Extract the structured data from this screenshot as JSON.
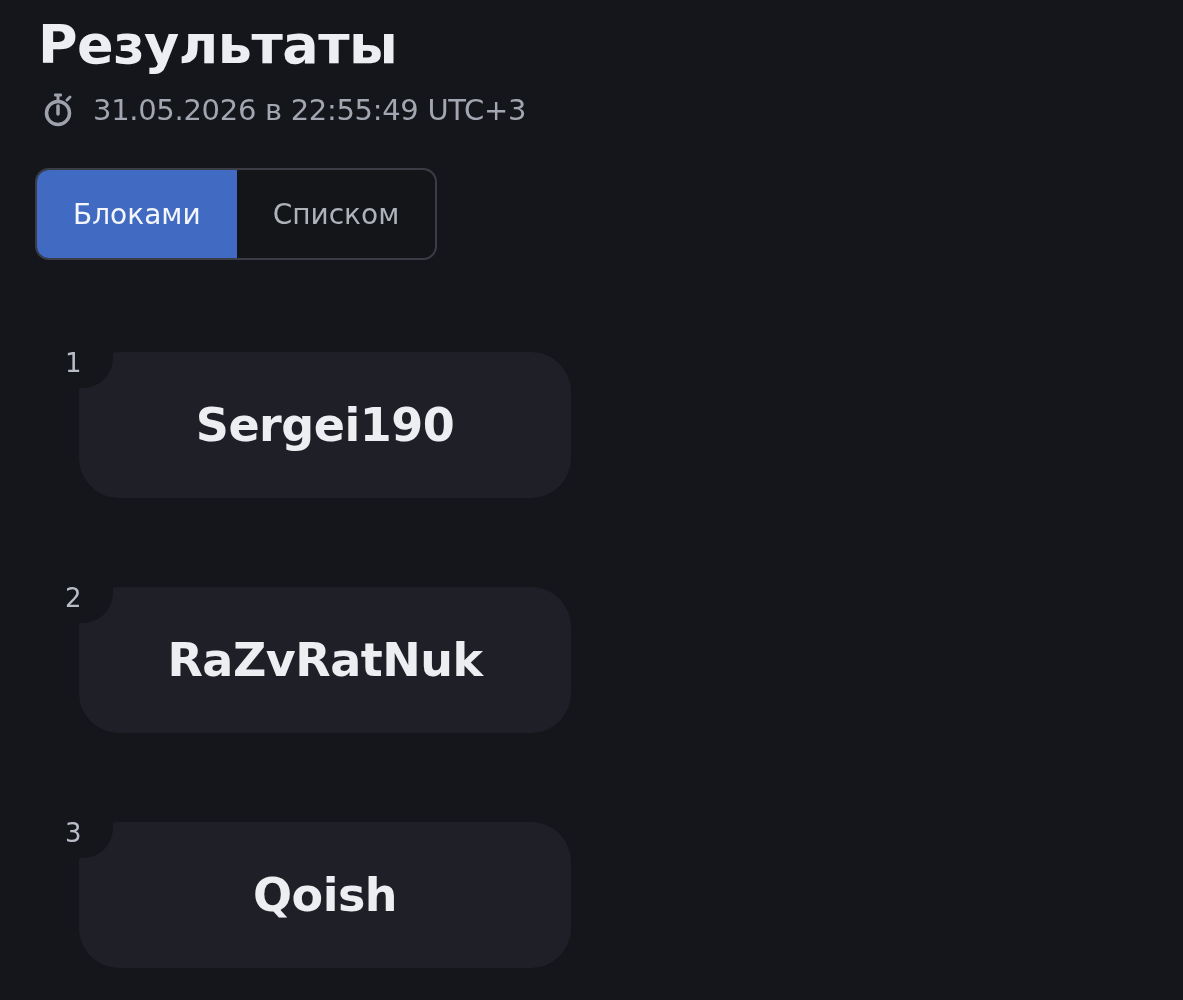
{
  "page": {
    "title": "Результаты",
    "timestamp": "31.05.2026 в 22:55:49 UTC+3"
  },
  "view_tabs": [
    {
      "label": "Блоками",
      "selected": true
    },
    {
      "label": "Списком",
      "selected": false
    }
  ],
  "results": [
    {
      "rank": "1",
      "name": "Sergei190"
    },
    {
      "rank": "2",
      "name": "RaZvRatNuk"
    },
    {
      "rank": "3",
      "name": "Qoish"
    }
  ]
}
